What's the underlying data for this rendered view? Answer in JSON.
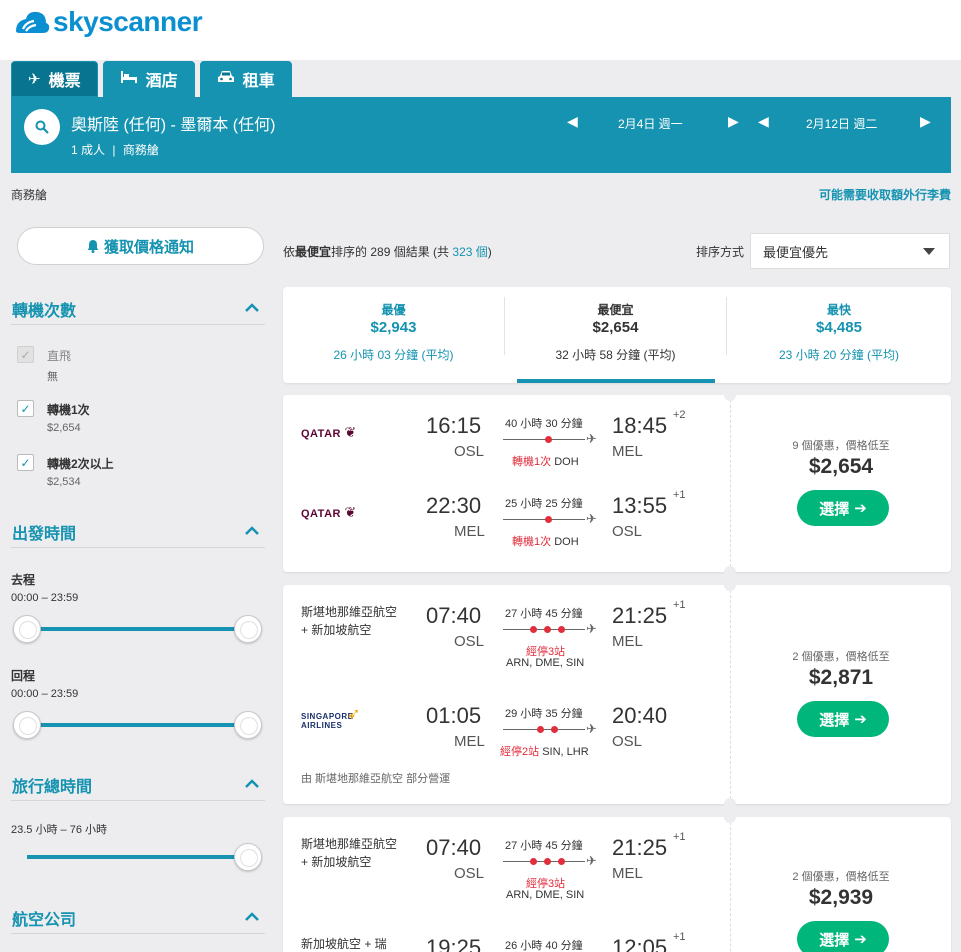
{
  "brand": {
    "name": "skyscanner",
    "color": "#0a8fd1"
  },
  "tabs": [
    {
      "label": "機票",
      "icon": "plane-icon",
      "active": true
    },
    {
      "label": "酒店",
      "icon": "bed-icon"
    },
    {
      "label": "租車",
      "icon": "car-icon"
    }
  ],
  "search": {
    "route": "奧斯陸 (任何) - 墨爾本 (任何)",
    "passengers": "1 成人",
    "cabin": "商務艙",
    "depart_date": "2月4日 週一",
    "return_date": "2月12日 週二"
  },
  "cabin_label": "商務艙",
  "baggage_notice": "可能需要收取額外行李費",
  "price_alert_label": "獲取價格通知",
  "filters": {
    "stops": {
      "title": "轉機次數",
      "options": [
        {
          "label": "直飛",
          "sub": "無",
          "checked": true,
          "disabled": true
        },
        {
          "label": "轉機1次",
          "sub": "$2,654",
          "checked": true
        },
        {
          "label": "轉機2次以上",
          "sub": "$2,534",
          "checked": true
        }
      ]
    },
    "times": {
      "title": "出發時間",
      "outbound_label": "去程",
      "outbound_range": "00:00 – 23:59",
      "return_label": "回程",
      "return_range": "00:00 – 23:59"
    },
    "duration": {
      "title": "旅行總時間",
      "range": "23.5 小時 – 76 小時"
    },
    "airlines": {
      "title": "航空公司"
    }
  },
  "results": {
    "prefix": "依",
    "sort_word": "最便宜",
    "middle": "排序的 289 個結果 (共 ",
    "total": "323 個",
    "suffix": ")"
  },
  "sort": {
    "label": "排序方式",
    "value": "最便宜優先"
  },
  "summary": [
    {
      "label": "最優",
      "price": "$2,943",
      "duration": "26 小時 03 分鐘 (平均)"
    },
    {
      "label": "最便宜",
      "price": "$2,654",
      "duration": "32 小時 58 分鐘 (平均)",
      "active": true
    },
    {
      "label": "最快",
      "price": "$4,485",
      "duration": "23 小時 20 分鐘 (平均)"
    }
  ],
  "itineraries": [
    {
      "deals": "9 個優惠，價格低至",
      "price": "$2,654",
      "select_label": "選擇",
      "legs": [
        {
          "airline": "QATAR",
          "dep_time": "16:15",
          "dep_airport": "OSL",
          "arr_time": "18:45",
          "arr_offset": "+2",
          "arr_airport": "MEL",
          "duration": "40 小時 30 分鐘",
          "stops_label": "轉機1次",
          "via": "DOH"
        },
        {
          "airline": "QATAR",
          "dep_time": "22:30",
          "dep_airport": "MEL",
          "arr_time": "13:55",
          "arr_offset": "+1",
          "arr_airport": "OSL",
          "duration": "25 小時 25 分鐘",
          "stops_label": "轉機1次",
          "via": "DOH"
        }
      ]
    },
    {
      "deals": "2 個優惠，價格低至",
      "price": "$2,871",
      "select_label": "選擇",
      "operated": "由 斯堪地那維亞航空 部分營運",
      "legs": [
        {
          "airline": "斯堪地那維亞航空 + 新加坡航空",
          "dep_time": "07:40",
          "dep_airport": "OSL",
          "arr_time": "21:25",
          "arr_offset": "+1",
          "arr_airport": "MEL",
          "duration": "27 小時 45 分鐘",
          "stops_label": "經停3站",
          "via": "ARN, DME, SIN"
        },
        {
          "airline": "SINGAPORE AIRLINES",
          "dep_time": "01:05",
          "dep_airport": "MEL",
          "arr_time": "20:40",
          "arr_offset": "",
          "arr_airport": "OSL",
          "duration": "29 小時 35 分鐘",
          "stops_label": "經停2站",
          "via": "SIN, LHR"
        }
      ]
    },
    {
      "deals": "2 個優惠，價格低至",
      "price": "$2,939",
      "select_label": "選擇",
      "legs": [
        {
          "airline": "斯堪地那維亞航空 + 新加坡航空",
          "dep_time": "07:40",
          "dep_airport": "OSL",
          "arr_time": "21:25",
          "arr_offset": "+1",
          "arr_airport": "MEL",
          "duration": "27 小時 45 分鐘",
          "stops_label": "經停3站",
          "via": "ARN, DME, SIN"
        },
        {
          "airline": "新加坡航空 + 瑞",
          "dep_time": "19:25",
          "dep_airport": "",
          "arr_time": "12:05",
          "arr_offset": "+1",
          "arr_airport": "",
          "duration": "26 小時 40 分鐘",
          "stops_label": "",
          "via": ""
        }
      ]
    }
  ]
}
